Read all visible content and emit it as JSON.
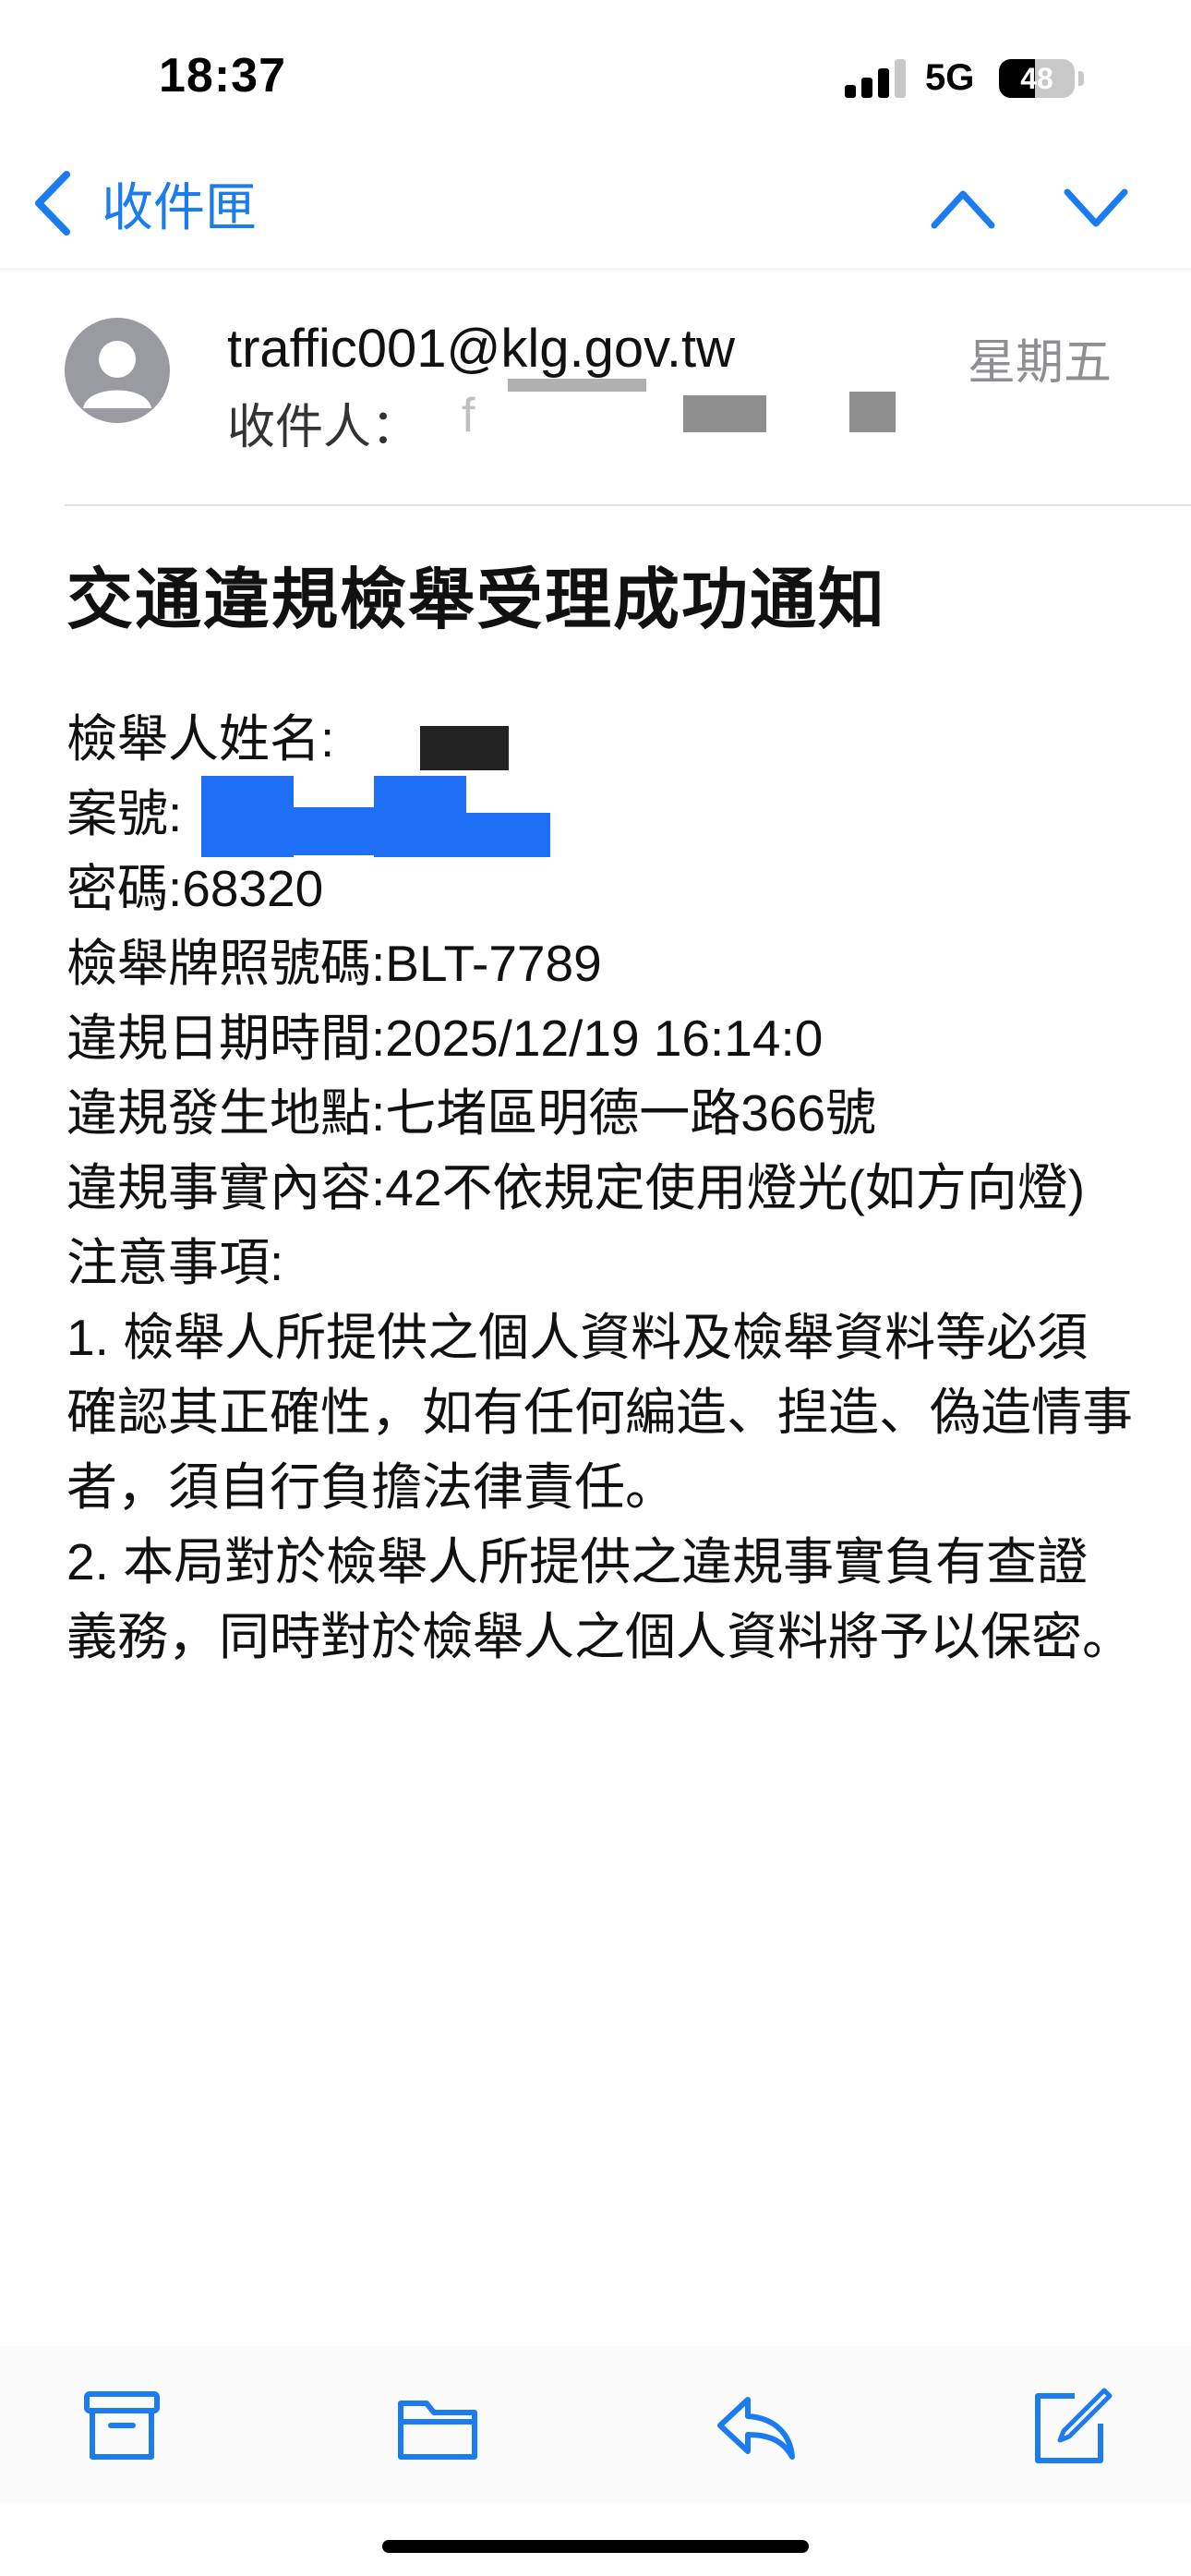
{
  "status_bar": {
    "time": "18:37",
    "network": "5G",
    "battery": "48",
    "battery_level": 0.48
  },
  "nav": {
    "back_label": "收件匣",
    "icons": [
      "chevron-left-icon",
      "chevron-up-icon",
      "chevron-down-icon"
    ]
  },
  "email": {
    "sender": "traffic001@klg.gov.tw",
    "date": "星期五",
    "to_label": "收件人：",
    "to_value": "f",
    "subject": "交通違規檢舉受理成功通知",
    "lines": {
      "reporter_name": "檢舉人姓名:",
      "case_number": "案號:",
      "password": "密碼:68320",
      "plate": "檢舉牌照號碼:BLT-7789",
      "datetime": "違規日期時間:2025/12/19 16:14:0",
      "location": "違規發生地點:七堵區明德一路366號",
      "violation": "違規事實內容:42不依規定使用燈光(如方向燈)",
      "notes_title": "注意事項:",
      "note1": "1. 檢舉人所提供之個人資料及檢舉資料等必須確認其正確性，如有任何編造、揑造、偽造情事者，須自行負擔法律責任。",
      "note2": "2. 本局對於檢舉人所提供之違規事實負有查證義務，同時對於檢舉人之個人資料將予以保密。"
    }
  },
  "toolbar": {
    "icons": [
      "archive-icon",
      "folder-icon",
      "reply-icon",
      "compose-icon"
    ]
  },
  "colors": {
    "accent": "#1a7cf0",
    "redaction_blue": "#1e6ff5",
    "secondary_text": "#8e8e93"
  }
}
